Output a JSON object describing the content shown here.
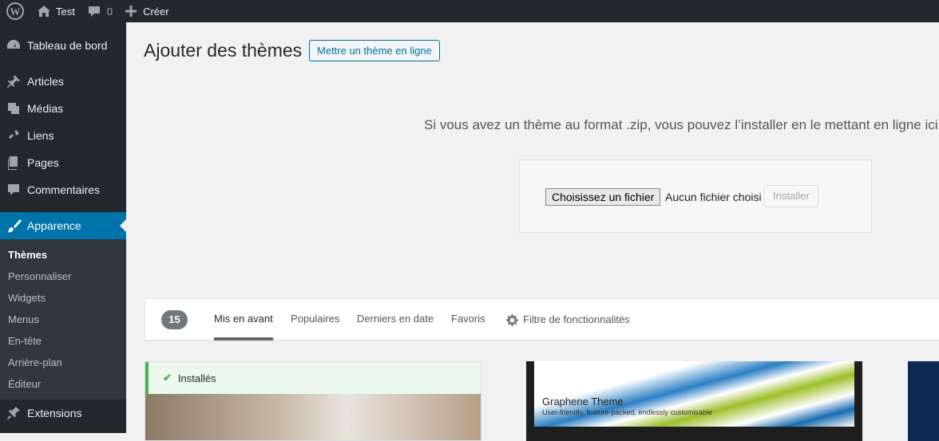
{
  "adminbar": {
    "site": "Test",
    "comments": "0",
    "new": "Créer"
  },
  "sidebar": {
    "items": [
      "Tableau de bord",
      "Articles",
      "Médias",
      "Liens",
      "Pages",
      "Commentaires",
      "Apparence",
      "Extensions"
    ],
    "submenu": [
      "Thèmes",
      "Personnaliser",
      "Widgets",
      "Menus",
      "En-tête",
      "Arrière-plan",
      "Éditeur"
    ]
  },
  "page": {
    "title": "Ajouter des thèmes",
    "upload_button": "Mettre un thème en ligne",
    "message": "Si vous avez un thème au format .zip, vous pouvez l’installer en le mettant en ligne ici.",
    "choose_file": "Choisissez un fichier",
    "no_file": "Aucun fichier choisi",
    "install": "Installer"
  },
  "filter": {
    "count": "15",
    "tabs": [
      "Mis en avant",
      "Populaires",
      "Derniers en date",
      "Favoris"
    ],
    "feature_filter": "Filtre de fonctionnalités"
  },
  "themes": {
    "installed": "Installés",
    "graphene_title": "Graphene Theme",
    "graphene_tagline": "User-friendly, feature-packed, endlessly customisable"
  }
}
